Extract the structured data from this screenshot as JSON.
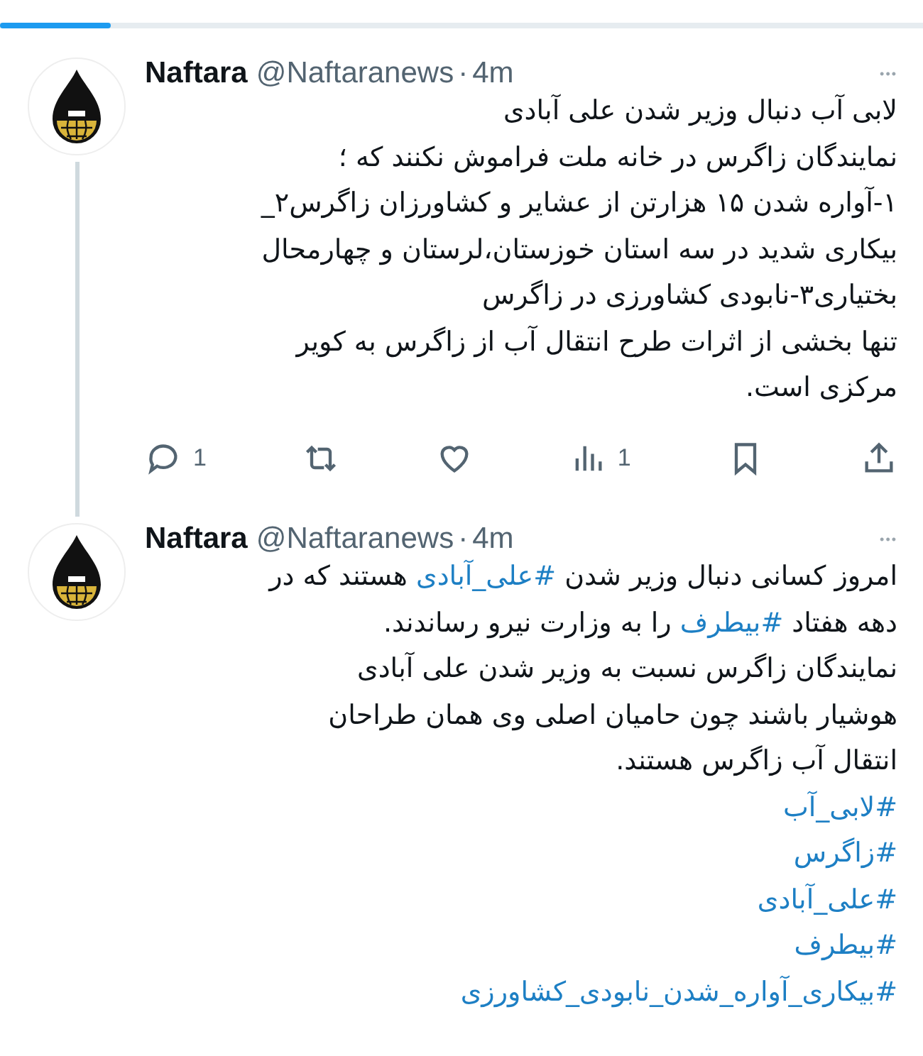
{
  "progress": {
    "level": 0.12
  },
  "tweets": [
    {
      "name": "Naftara",
      "handle": "@Naftaranews",
      "dot": "·",
      "time": "4m",
      "more": "•••",
      "thread_line": true,
      "lines": [
        [
          {
            "text": "لابی آب  دنبال وزیر شدن علی آبادی"
          }
        ],
        [
          {
            "text": "نمایندگان زاگرس در خانه ملت فراموش نکنند که ؛"
          }
        ],
        [
          {
            "text": "۱-آواره شدن ۱۵ هزارتن از عشایر و کشاورزان زاگرس۲_"
          }
        ],
        [
          {
            "text": "بیکاری شدید در سه استان خوزستان،لرستان و چهارمحال"
          }
        ],
        [
          {
            "text": "بختیاری۳-نابودی کشاورزی در زاگرس"
          }
        ],
        [
          {
            "text": "تنها بخشی از اثرات طرح انتقال آب از زاگرس به کویر"
          }
        ],
        [
          {
            "text": "مرکزی است."
          }
        ]
      ],
      "actions": [
        {
          "kind": "share"
        },
        {
          "kind": "bookmark"
        },
        {
          "kind": "views",
          "count": "1"
        },
        {
          "kind": "like"
        },
        {
          "kind": "retweet"
        },
        {
          "kind": "reply",
          "count": "1"
        }
      ]
    },
    {
      "name": "Naftara",
      "handle": "@Naftaranews",
      "dot": "·",
      "time": "4m",
      "more": "•••",
      "lines": [
        [
          {
            "text": "امروز کسانی دنبال وزیر شدن "
          },
          {
            "text": "#علی_آبادی",
            "link": true
          },
          {
            "text": " هستند که در"
          }
        ],
        [
          {
            "text": "دهه هفتاد "
          },
          {
            "text": "#بیطرف",
            "link": true
          },
          {
            "text": " را به وزارت نیرو رساندند."
          }
        ],
        [
          {
            "text": "نمایندگان زاگرس نسبت به وزیر شدن علی آبادی"
          }
        ],
        [
          {
            "text": "هوشیار باشند چون حامیان اصلی وی همان طراحان"
          }
        ],
        [
          {
            "text": "انتقال آب زاگرس هستند."
          }
        ],
        [
          {
            "text": "#لابی_آب",
            "link": true
          }
        ],
        [
          {
            "text": "#زاگرس",
            "link": true
          }
        ],
        [
          {
            "text": "#علی_آبادی",
            "link": true
          }
        ],
        [
          {
            "text": "#بیطرف",
            "link": true
          }
        ],
        [
          {
            "text": "#بیکاری_آواره_شدن_نابودی_کشاورزی",
            "link": true
          }
        ]
      ]
    }
  ]
}
